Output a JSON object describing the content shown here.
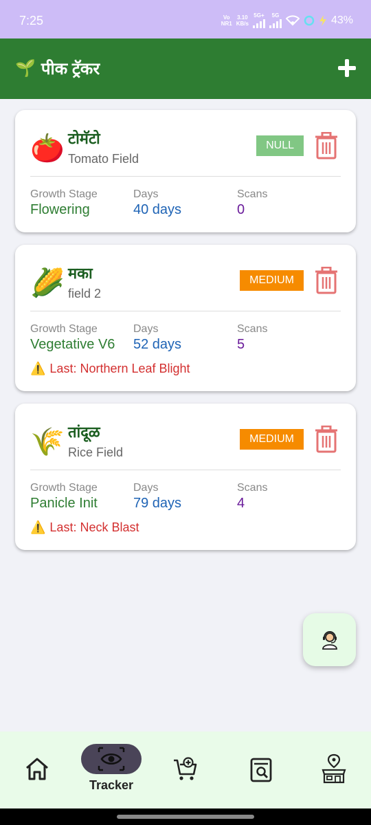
{
  "status_bar": {
    "time": "7:25",
    "carrier_top": "Vo",
    "carrier_bottom": "NR1",
    "speed_top": "3.10",
    "speed_bottom": "KB/s",
    "net1": "5G+",
    "net2": "5G",
    "battery": "43%"
  },
  "app_bar": {
    "icon": "seedling-icon",
    "title": "पीक ट्रॅकर",
    "add_icon": "plus-icon"
  },
  "crops": [
    {
      "emoji": "🍅",
      "name": "टोमॅटो",
      "field": "Tomato Field",
      "risk": "NULL",
      "risk_color": "#81c784",
      "stage_label": "Growth Stage",
      "stage": "Flowering",
      "days_label": "Days",
      "days": "40 days",
      "scans_label": "Scans",
      "scans": "0"
    },
    {
      "emoji": "🌽",
      "name": "मका",
      "field": "field 2",
      "risk": "MEDIUM",
      "risk_color": "#f68b00",
      "stage_label": "Growth Stage",
      "stage": "Vegetative V6",
      "days_label": "Days",
      "days": "52 days",
      "scans_label": "Scans",
      "scans": "5",
      "last": "Last: Northern Leaf Blight"
    },
    {
      "emoji": "🌾",
      "name": "तांदूळ",
      "field": "Rice Field",
      "risk": "MEDIUM",
      "risk_color": "#f68b00",
      "stage_label": "Growth Stage",
      "stage": "Panicle Init",
      "days_label": "Days",
      "days": "79 days",
      "scans_label": "Scans",
      "scans": "4",
      "last": "Last: Neck Blast"
    }
  ],
  "fab": {
    "icon": "support-agent-icon"
  },
  "bottom_nav": {
    "items": [
      {
        "icon": "home-icon"
      },
      {
        "icon": "eye-icon",
        "label": "Tracker",
        "active": true
      },
      {
        "icon": "cart-add-icon"
      },
      {
        "icon": "search-document-icon"
      },
      {
        "icon": "store-location-icon"
      }
    ]
  },
  "colors": {
    "primary": "#2e7d32",
    "status_bar": "#cdbcf7",
    "warning_text": "#d32f2f",
    "days_text": "#1e63b5",
    "scans_text": "#6a1b9a",
    "active_nav_pill": "#4a4458"
  }
}
